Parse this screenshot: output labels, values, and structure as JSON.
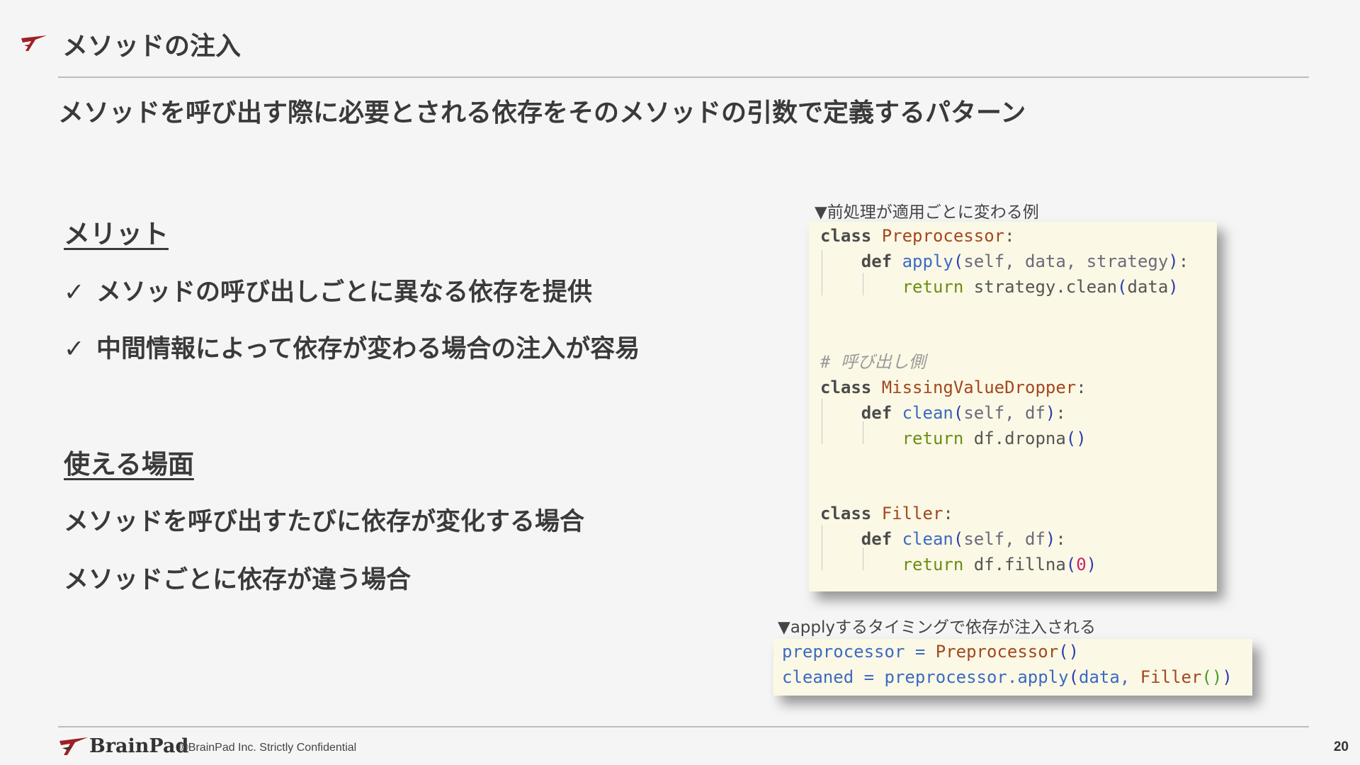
{
  "slide": {
    "title": "メソッドの注入",
    "subtitle": "メソッドを呼び出す際に必要とされる依存をそのメソッドの引数で定義するパターン"
  },
  "merits": {
    "heading": "メリット",
    "items": [
      "メソッドの呼び出しごとに異なる依存を提供",
      "中間情報によって依存が変わる場合の注入が容易"
    ],
    "check_glyph": "✓"
  },
  "use_cases": {
    "heading": "使える場面",
    "items": [
      "メソッドを呼び出すたびに依存が変化する場合",
      "メソッドごとに依存が違う場合"
    ]
  },
  "code_example_1": {
    "caption": "▼前処理が適用ごとに変わる例",
    "l1_kw": "class",
    "l1_cls": "Preprocessor",
    "l1_end": ":",
    "l2_kw": "def",
    "l2_fn": "apply",
    "l2_p1": "(",
    "l2_args": "self, data, strategy",
    "l2_p2": ")",
    "l2_end": ":",
    "l3_kw": "return",
    "l3_a": "strategy.clean",
    "l3_p1": "(",
    "l3_b": "data",
    "l3_p2": ")",
    "l4_cmt": "# 呼び出し側",
    "l5_kw": "class",
    "l5_cls": "MissingValueDropper",
    "l5_end": ":",
    "l6_kw": "def",
    "l6_fn": "clean",
    "l6_p1": "(",
    "l6_args": "self, df",
    "l6_p2": ")",
    "l6_end": ":",
    "l7_kw": "return",
    "l7_a": "df.dropna",
    "l7_p": "()",
    "l8_kw": "class",
    "l8_cls": "Filler",
    "l8_end": ":",
    "l9_kw": "def",
    "l9_fn": "clean",
    "l9_p1": "(",
    "l9_args": "self, df",
    "l9_p2": ")",
    "l9_end": ":",
    "l10_kw": "return",
    "l10_a": "df.fillna",
    "l10_p1": "(",
    "l10_num": "0",
    "l10_p2": ")"
  },
  "code_example_2": {
    "caption": "▼applyするタイミングで依存が注入される",
    "l1_a": "preprocessor = ",
    "l1_cls": "Preprocessor",
    "l1_p": "()",
    "l2_a": "cleaned = preprocessor.apply",
    "l2_p1": "(",
    "l2_b": "data, ",
    "l2_cls": "Filler",
    "l2_p2": "()",
    "l2_p3": ")"
  },
  "footer": {
    "brand": "BrainPad",
    "copyright": "©BrainPad Inc.  Strictly Confidential",
    "page_number": "20"
  },
  "colors": {
    "accent": "#a01f24",
    "code_background": "#fbf8e6",
    "text": "#3a3a3a"
  },
  "icons": [
    "brainpad-logo-mark",
    "check-icon"
  ]
}
